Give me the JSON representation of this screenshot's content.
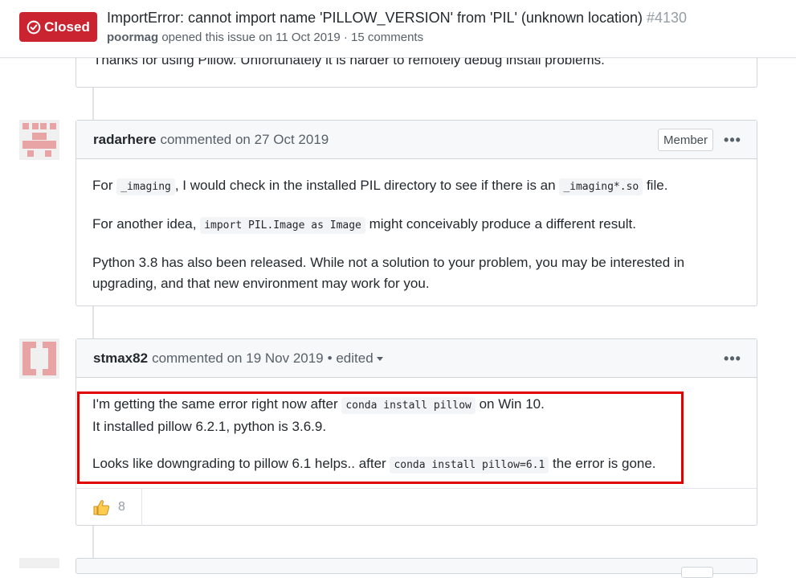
{
  "issue": {
    "state_label": "Closed",
    "title": "ImportError: cannot import name 'PILLOW_VERSION' from 'PIL' (unknown location)",
    "number": "#4130",
    "author": "poormag",
    "meta_text": "opened this issue on 11 Oct 2019 · 15 comments",
    "state_color": "#cb2431"
  },
  "prev_comment": {
    "text": "Thanks for using Pillow. Unfortunately it is harder to remotely debug install problems."
  },
  "comment1": {
    "author": "radarhere",
    "action": "commented on 27 Oct 2019",
    "role": "Member",
    "menu": "•••",
    "p1_a": "For ",
    "p1_code1": "_imaging",
    "p1_b": ", I would check in the installed PIL directory to see if there is an ",
    "p1_code2": "_imaging*.so",
    "p1_c": " file.",
    "p2_a": "For another idea, ",
    "p2_code": "import PIL.Image as Image",
    "p2_b": " might conceivably produce a different result.",
    "p3_line1": "Python 3.8 has also been released. While not a solution to your problem, you may be interested in",
    "p3_line2": "upgrading, and that new environment may work for you."
  },
  "comment2": {
    "author": "stmax82",
    "action": "commented on 19 Nov 2019",
    "edited": "• edited",
    "menu": "•••",
    "l1_a": "I'm getting the same error right now after ",
    "l1_code": "conda install pillow",
    "l1_b": " on Win 10.",
    "l2": "It installed pillow 6.2.1, python is 3.6.9.",
    "l3_a": "Looks like downgrading to pillow 6.1 helps.. after ",
    "l3_code": "conda install pillow=6.1",
    "l3_b": " the error is gone.",
    "reaction_icon": "thumbs-up",
    "reaction_count": "8"
  },
  "colors": {
    "highlight": "#e00000",
    "link": "#24292e"
  }
}
